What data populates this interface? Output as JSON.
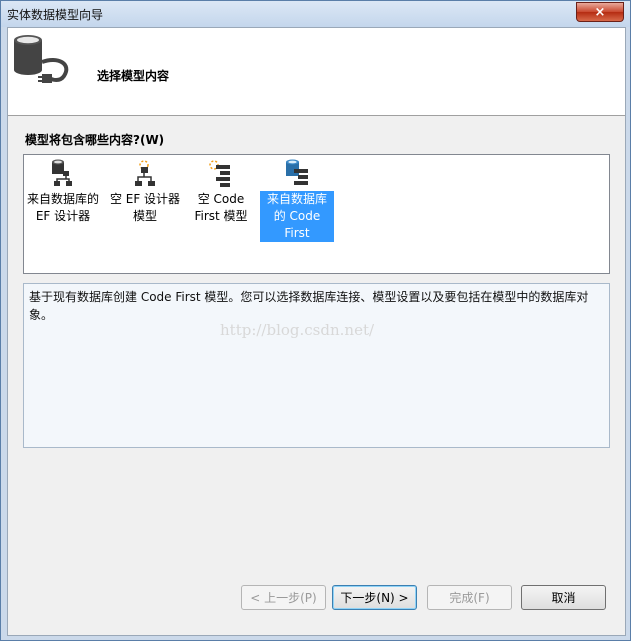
{
  "window": {
    "title": "实体数据模型向导",
    "close_symbol": "×"
  },
  "header": {
    "title": "选择模型内容",
    "icon": "database-plug-icon"
  },
  "prompt": "模型将包含哪些内容?(W)",
  "items": [
    {
      "label": "来自数据库的 EF 设计器",
      "icon": "database-designer-icon",
      "selected": false
    },
    {
      "label": "空 EF 设计器 模型",
      "icon": "empty-designer-icon",
      "selected": false
    },
    {
      "label": "空 Code First 模型",
      "icon": "empty-code-first-icon",
      "selected": false
    },
    {
      "label": "来自数据库 的 Code First",
      "icon": "database-code-first-icon",
      "selected": true
    }
  ],
  "description": "基于现有数据库创建 Code First 模型。您可以选择数据库连接、模型设置以及要包括在模型中的数据库对象。",
  "watermark": "http://blog.csdn.net/",
  "buttons": {
    "back": "< 上一步(P)",
    "next": "下一步(N) >",
    "finish": "完成(F)",
    "cancel": "取消"
  },
  "colors": {
    "selection": "#3399ff",
    "title_bar": "#c4d6ec"
  }
}
